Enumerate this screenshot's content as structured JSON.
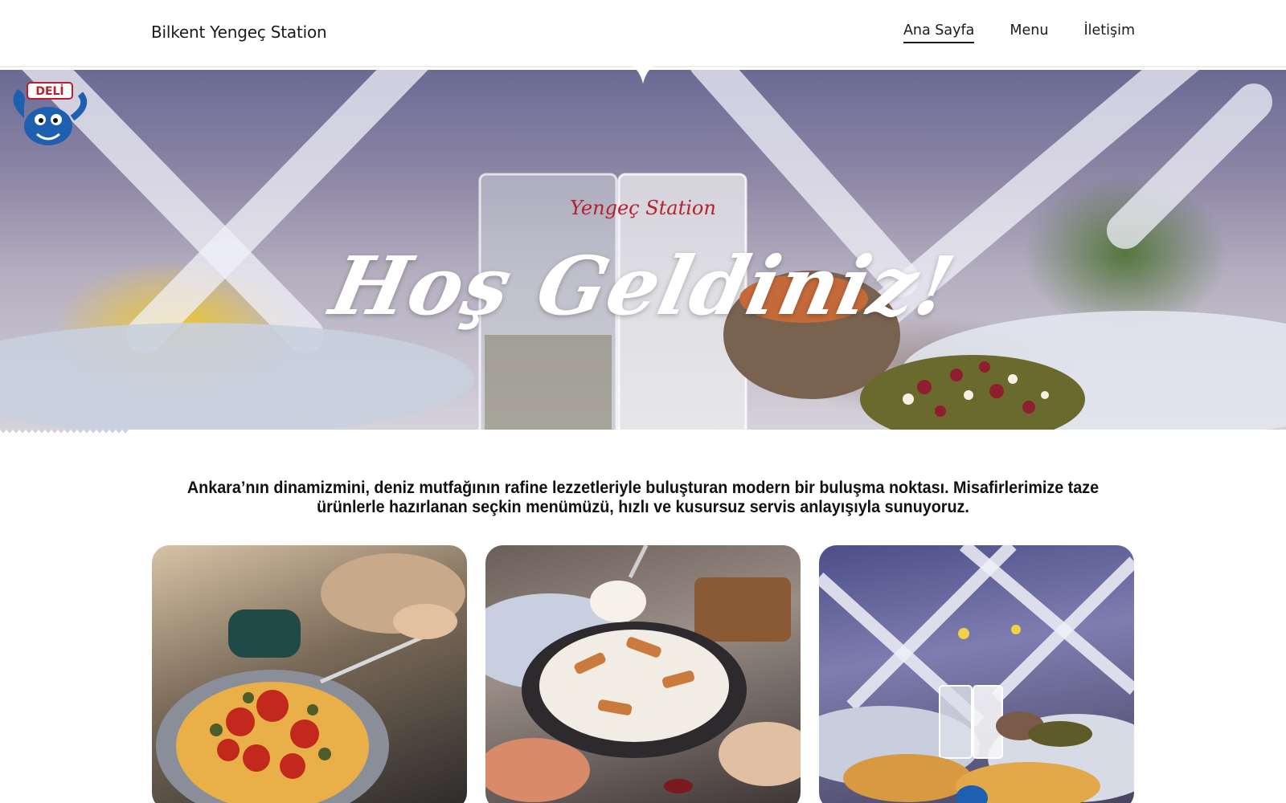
{
  "header": {
    "brand": "Bilkent Yengeç Station",
    "nav": [
      {
        "label": "Ana Sayfa",
        "active": true
      },
      {
        "label": "Menu",
        "active": false
      },
      {
        "label": "İletişim",
        "active": false
      }
    ]
  },
  "hero": {
    "title": "Hoş Geldiniz!",
    "logo": {
      "top_text": "DELİ",
      "script_text": "Yengeç Station"
    }
  },
  "intro": {
    "text": "Ankara’nın dinamizmini, deniz mutfağının rafine lezzetleriyle buluşturan modern bir buluşma noktası. Misafirlerimize taze ürünlerle hazırlanan seçkin menümüzü, hızlı ve kusursuz servis anlayışıyla sunuyoruz."
  },
  "gallery": [
    {
      "subject": "tomato-pepper-appetizer-photo"
    },
    {
      "subject": "yogurt-eggplant-meze-photo"
    },
    {
      "subject": "restaurant-table-raki-photo"
    }
  ],
  "colors": {
    "text": "#111111",
    "background": "#ffffff",
    "logo_red": "#b8202c",
    "logo_blue": "#1f5fb0"
  }
}
